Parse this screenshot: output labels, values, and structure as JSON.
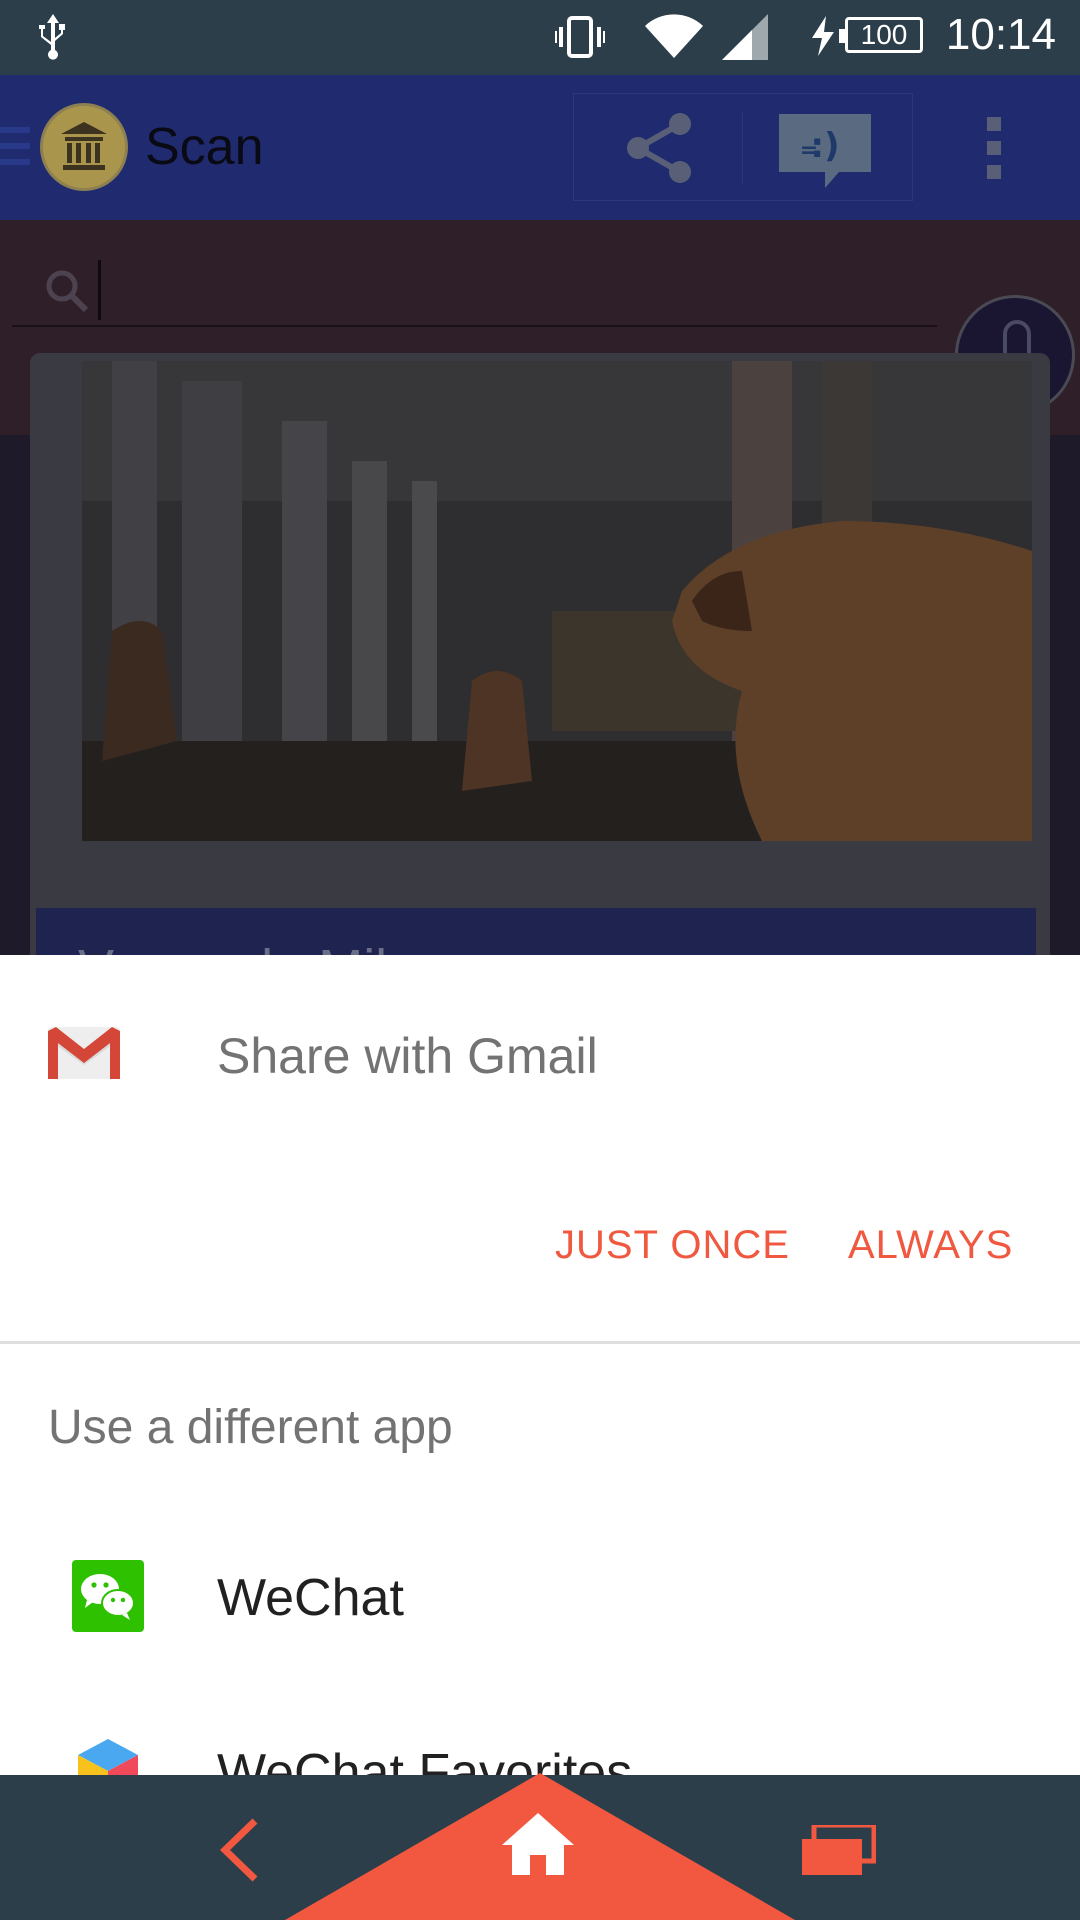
{
  "status_bar": {
    "battery": "100",
    "time": "10:14",
    "icons": [
      "usb-icon",
      "vibrate-icon",
      "wifi-icon",
      "signal-icon",
      "charging-icon",
      "battery-icon"
    ]
  },
  "app": {
    "title": "Scan",
    "search": {
      "value": ""
    },
    "card": {
      "caption": "Venus de Milo"
    },
    "toolbar_icons": [
      "menu-icon",
      "museum-logo-icon",
      "share-icon",
      "feedback-icon",
      "overflow-menu-icon",
      "mic-icon"
    ]
  },
  "share_sheet": {
    "preferred_app": "Share with Gmail",
    "buttons": {
      "just_once": "JUST ONCE",
      "always": "ALWAYS"
    },
    "section_header": "Use a different app",
    "apps": [
      {
        "label": "WeChat",
        "icon": "wechat-icon"
      },
      {
        "label": "WeChat Favorites",
        "icon": "wechat-favorites-icon"
      }
    ],
    "colors": {
      "accent": "#f05840",
      "text_secondary": "#737373",
      "text_primary": "#212121"
    }
  },
  "nav_bar": {
    "icons": [
      "back-icon",
      "home-icon",
      "recents-icon"
    ],
    "colors": {
      "background": "#2c3e4a",
      "accent": "#f05840"
    }
  }
}
